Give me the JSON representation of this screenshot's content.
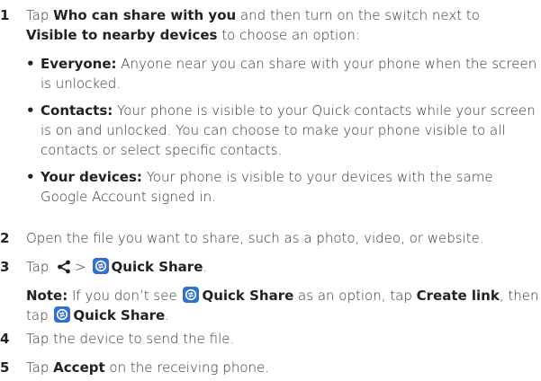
{
  "steps": [
    {
      "num": "1",
      "pre": "Tap ",
      "b1": "Who can share with you",
      "mid": " and then turn on the switch next to ",
      "b2": "Visible to nearby devices",
      "post": " to choose an option:"
    },
    {
      "num": "2",
      "text": "Open the file you want to share, such as a photo, video, or website."
    },
    {
      "num": "3",
      "pre": "Tap ",
      "sep": ">",
      "qs": "Quick Share",
      "end": "."
    },
    {
      "num": "4",
      "text": "Tap the device to send the file."
    },
    {
      "num": "5",
      "pre": "Tap ",
      "b": "Accept",
      "post": " on the receiving phone."
    }
  ],
  "bullets": [
    {
      "dot": "•",
      "label": "Everyone:",
      "text": " Anyone near you can share with your phone when the screen is unlocked."
    },
    {
      "dot": "•",
      "label": "Contacts:",
      "text": " Your phone is visible to your Quick contacts while your screen is on and unlocked. You can choose to make your phone visible to all contacts or select specific contacts."
    },
    {
      "dot": "•",
      "label": "Your devices:",
      "text": " Your phone is visible to your devices with the same Google Account signed in."
    }
  ],
  "note": {
    "label": "Note:",
    "t1": " If you don’t see ",
    "qs1": "Quick Share",
    "t2": " as an option, tap ",
    "b2": "Create link",
    "t3": ", then tap ",
    "qs2": "Quick Share",
    "t4": "."
  },
  "icons": {
    "share": "share-icon",
    "quick_share": "quick-share-icon"
  },
  "colors": {
    "quick_share_icon": "#2f6fd6",
    "text": "#333333"
  }
}
